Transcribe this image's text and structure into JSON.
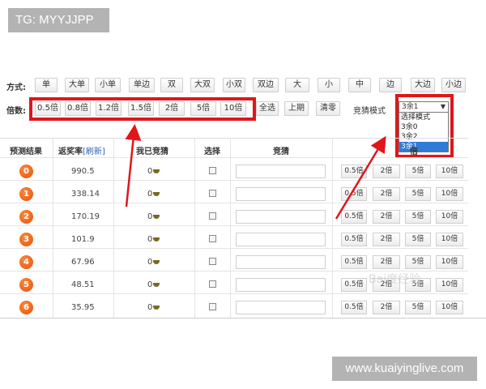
{
  "watermarks": {
    "top": "TG: MYYJJPP",
    "bottom": "www.kuaiyinglive.com",
    "baidu": "Bai度经验"
  },
  "mode_row": {
    "label": "方式:",
    "buttons": [
      "单",
      "大单",
      "小单",
      "单边",
      "双",
      "大双",
      "小双",
      "双边",
      "大",
      "小",
      "中",
      "边",
      "大边",
      "小边"
    ]
  },
  "mult_row": {
    "label": "倍数:",
    "buttons": [
      "0.5倍",
      "0.8倍",
      "1.2倍",
      "1.5倍",
      "2倍",
      "5倍",
      "10倍"
    ],
    "select_all": "全选",
    "previous": "上期",
    "clear": "清零"
  },
  "bet_mode": {
    "label": "竞猜模式",
    "selected": "3余1",
    "options": [
      "选择模式",
      "3余0",
      "3余2",
      "3余1"
    ]
  },
  "table": {
    "headers": {
      "result": "预测结果",
      "rate": "返奖率",
      "refresh": "[刷新]",
      "my_bets": "我已竞猜",
      "select": "选择",
      "bet": "竞猜",
      "multiplier_partial": "倍"
    },
    "row_buttons": [
      "0.5倍",
      "2倍",
      "5倍",
      "10倍"
    ],
    "rows": [
      {
        "num": "0",
        "rate": "990.5",
        "bet": "0"
      },
      {
        "num": "1",
        "rate": "338.14",
        "bet": "0"
      },
      {
        "num": "2",
        "rate": "170.19",
        "bet": "0"
      },
      {
        "num": "3",
        "rate": "101.9",
        "bet": "0"
      },
      {
        "num": "4",
        "rate": "67.96",
        "bet": "0"
      },
      {
        "num": "5",
        "rate": "48.51",
        "bet": "0"
      },
      {
        "num": "6",
        "rate": "35.95",
        "bet": "0"
      }
    ]
  },
  "colors": {
    "highlight": "#e0161b",
    "number_ball": "#e84e0c",
    "selected_option": "#2f7bd6"
  }
}
